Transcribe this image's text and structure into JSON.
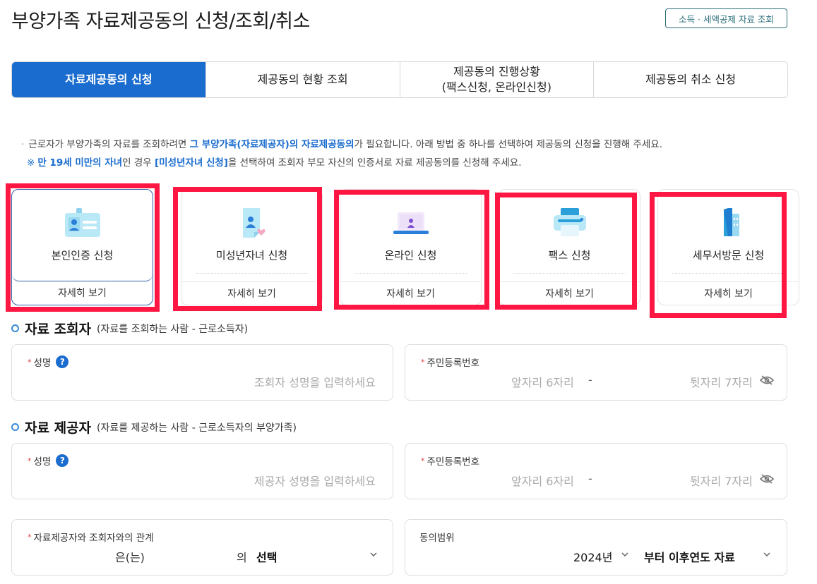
{
  "header": {
    "title": "부양가족 자료제공동의 신청/조회/취소",
    "link": "소득 · 세액공제 자료 조회"
  },
  "tabs": [
    {
      "label": "자료제공동의 신청",
      "active": true
    },
    {
      "label": "제공동의 현황 조회",
      "active": false
    },
    {
      "label": "제공동의 진행상황\n(팩스신청, 온라인신청)",
      "active": false
    },
    {
      "label": "제공동의 취소 신청",
      "active": false
    }
  ],
  "notice": {
    "line1_a": "근로자가 부양가족의 자료를 조회하려면 ",
    "line1_hl": "그 부양가족(자료제공자)의 자료제공동의",
    "line1_b": "가 필요합니다. 아래 방법 중 하나를 선택하여 제공동의 신청을 진행해 주세요.",
    "line2_ref": "※",
    "line2_hl1": "만 19세 미만의 자녀",
    "line2_a": "인 경우 ",
    "line2_hl2": "[미성년자녀 신청]",
    "line2_b": "을 선택하여 조회자 부모 자신의 인증서로 자료 제공동의를 신청해 주세요."
  },
  "cards": [
    {
      "label": "본인인증 신청",
      "more": "자세히 보기",
      "icon": "id-card-icon",
      "selected": true
    },
    {
      "label": "미성년자녀 신청",
      "more": "자세히 보기",
      "icon": "child-document-icon",
      "selected": false
    },
    {
      "label": "온라인 신청",
      "more": "자세히 보기",
      "icon": "laptop-icon",
      "selected": false
    },
    {
      "label": "팩스 신청",
      "more": "자세히 보기",
      "icon": "fax-printer-icon",
      "selected": false
    },
    {
      "label": "세무서방문 신청",
      "more": "자세히 보기",
      "icon": "building-icon",
      "selected": false
    }
  ],
  "viewer": {
    "title": "자료 조회자",
    "subtitle": "(자료를 조회하는 사람 - 근로소득자)",
    "name_label": "성명",
    "name_help": "?",
    "name_placeholder": "조회자 성명을 입력하세요",
    "rrn_label": "주민등록번호",
    "rrn_front_placeholder": "앞자리 6자리",
    "rrn_sep": "-",
    "rrn_back_placeholder": "뒷자리 7자리"
  },
  "provider": {
    "title": "자료 제공자",
    "subtitle": "(자료를 제공하는 사람 - 근로소득자의 부양가족)",
    "name_label": "성명",
    "name_help": "?",
    "name_placeholder": "제공자 성명을 입력하세요",
    "rrn_label": "주민등록번호",
    "rrn_front_placeholder": "앞자리 6자리",
    "rrn_sep": "-",
    "rrn_back_placeholder": "뒷자리 7자리"
  },
  "relation": {
    "label": "자료제공자와 조회자와의 관계",
    "subject": "은(는)",
    "particle": "의",
    "select_value": "선택"
  },
  "scope": {
    "label": "동의범위",
    "year_value": "2024년",
    "range_value": "부터 이후연도 자료"
  },
  "colors": {
    "primary": "#1a6ccf",
    "highlight_box": "#ff1744",
    "required_star": "#e03c3c"
  }
}
